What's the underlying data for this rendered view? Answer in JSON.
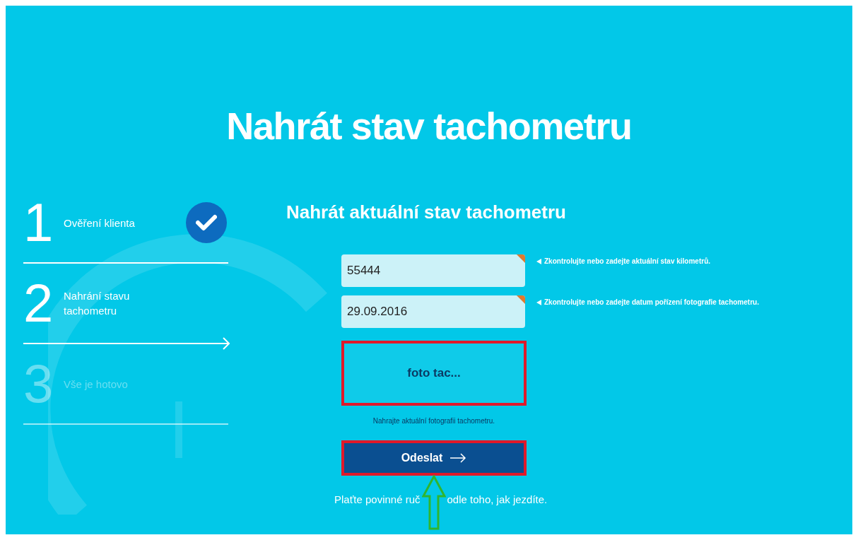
{
  "title": "Nahrát stav tachometru",
  "steps": [
    {
      "number": "1",
      "label": "Ověření klienta",
      "done": true,
      "selected": false,
      "disabled": false
    },
    {
      "number": "2",
      "label": "Nahrání stavu tachometru",
      "done": false,
      "selected": true,
      "disabled": false
    },
    {
      "number": "3",
      "label": "Vše je hotovo",
      "done": false,
      "selected": false,
      "disabled": true
    }
  ],
  "form": {
    "heading": "Nahrát aktuální stav tachometru",
    "fields": [
      {
        "value": "55444",
        "required": true,
        "hint": "Zkontrolujte nebo zadejte aktuální stav kilometrů."
      },
      {
        "value": "29.09.2016",
        "required": true,
        "hint": "Zkontrolujte nebo zadejte datum pořízení fotografie tachometru."
      }
    ],
    "upload": {
      "label": "foto tac...",
      "highlighted": true
    },
    "upload_hint": "Nahrajte aktuální fotografii tachometru.",
    "submit": {
      "label": "Odeslat",
      "highlighted": true
    }
  },
  "footer_text_parts": [
    "Plaťte povinné ruč",
    "odle toho, jak jezdíte."
  ]
}
